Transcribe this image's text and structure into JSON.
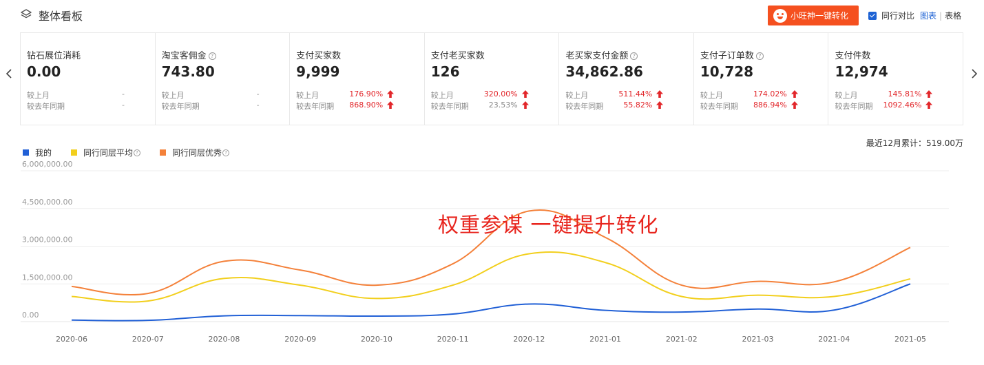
{
  "header": {
    "title": "整体看板",
    "promo_button": "小旺神一键转化",
    "compare_label": "同行对比",
    "view_chart": "图表",
    "view_sep": "|",
    "view_table": "表格"
  },
  "cards": [
    {
      "name": "钻石展位消耗",
      "help": false,
      "value": "0.00",
      "mom_label": "较上月",
      "mom": "-",
      "yoy_label": "较去年同期",
      "yoy": "-"
    },
    {
      "name": "淘宝客佣金",
      "help": true,
      "value": "743.80",
      "mom_label": "较上月",
      "mom": "-",
      "yoy_label": "较去年同期",
      "yoy": "-"
    },
    {
      "name": "支付买家数",
      "help": false,
      "value": "9,999",
      "mom_label": "较上月",
      "mom": "176.90%",
      "yoy_label": "较去年同期",
      "yoy": "868.90%"
    },
    {
      "name": "支付老买家数",
      "help": false,
      "value": "126",
      "mom_label": "较上月",
      "mom": "320.00%",
      "yoy_label": "较去年同期",
      "yoy": "23.53%"
    },
    {
      "name": "老买家支付金额",
      "help": true,
      "value": "34,862.86",
      "mom_label": "较上月",
      "mom": "511.44%",
      "yoy_label": "较去年同期",
      "yoy": "55.82%"
    },
    {
      "name": "支付子订单数",
      "help": true,
      "value": "10,728",
      "mom_label": "较上月",
      "mom": "174.02%",
      "yoy_label": "较去年同期",
      "yoy": "886.94%"
    },
    {
      "name": "支付件数",
      "help": false,
      "value": "12,974",
      "mom_label": "较上月",
      "mom": "145.81%",
      "yoy_label": "较去年同期",
      "yoy": "1092.46%"
    }
  ],
  "legend": {
    "mine": "我的",
    "avg": "同行同层平均",
    "excellent": "同行同层优秀"
  },
  "total_label": "最近12月累计：519.00万",
  "overlay_text": "权重参谋  一键提升转化",
  "colors": {
    "mine": "#2160d6",
    "avg": "#f2cf1d",
    "excellent": "#f4813a",
    "up": "#e2262a",
    "accent": "#f5501f"
  },
  "chart_data": {
    "type": "line",
    "x": [
      "2020-06",
      "2020-07",
      "2020-08",
      "2020-09",
      "2020-10",
      "2020-11",
      "2020-12",
      "2021-01",
      "2021-02",
      "2021-03",
      "2021-04",
      "2021-05"
    ],
    "y_ticks": [
      "0.00",
      "1,500,000.00",
      "3,000,000.00",
      "4,500,000.00",
      "6,000,000.00"
    ],
    "ylim": [
      0,
      6000000
    ],
    "grid": true,
    "series": [
      {
        "name": "我的",
        "values": [
          60000,
          50000,
          230000,
          240000,
          220000,
          300000,
          700000,
          450000,
          380000,
          500000,
          460000,
          1500000
        ]
      },
      {
        "name": "同行同层平均",
        "values": [
          1000000,
          820000,
          1720000,
          1450000,
          920000,
          1450000,
          2700000,
          2350000,
          1000000,
          1050000,
          1000000,
          1700000
        ]
      },
      {
        "name": "同行同层优秀",
        "values": [
          1400000,
          1120000,
          2400000,
          2050000,
          1450000,
          2300000,
          4400000,
          3350000,
          1450000,
          1600000,
          1580000,
          2950000
        ]
      }
    ]
  }
}
